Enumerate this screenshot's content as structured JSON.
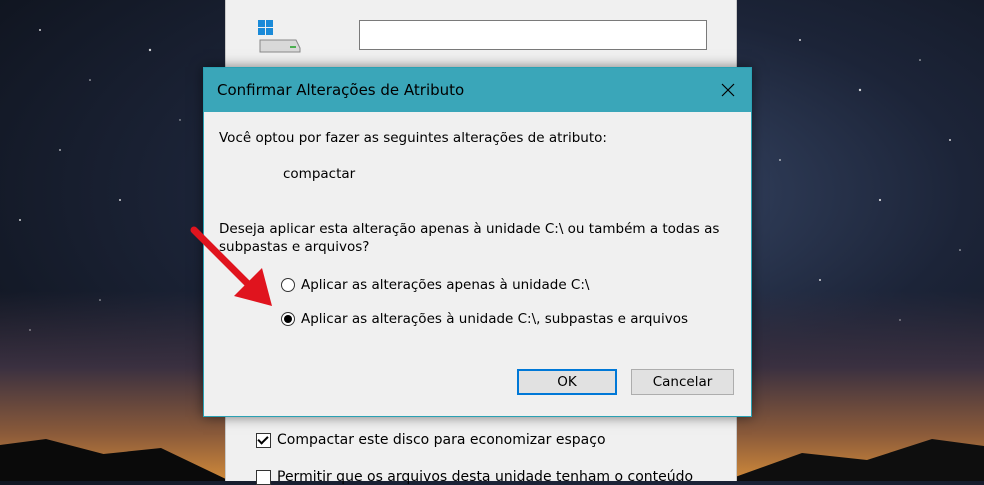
{
  "background_panel": {
    "drive_name_value": "",
    "compress_checkbox_label": "Compactar este disco para economizar espaço",
    "compress_checked": true,
    "index_checkbox_label": "Permitir que os arquivos desta unidade tenham o conteúdo",
    "index_checked": false
  },
  "dialog": {
    "title": "Confirmar Alterações de Atributo",
    "intro": "Você optou por fazer as seguintes alterações de atributo:",
    "change": "compactar",
    "question_line1": "Deseja aplicar esta alteração apenas à unidade C:\\ ou também a todas as",
    "question_line2": "subpastas e arquivos?",
    "options": [
      {
        "label": "Aplicar as alterações apenas à unidade C:\\",
        "selected": false
      },
      {
        "label": "Aplicar as alterações à unidade C:\\, subpastas e arquivos",
        "selected": true
      }
    ],
    "ok_label": "OK",
    "cancel_label": "Cancelar"
  },
  "colors": {
    "titlebar": "#3aa6b9",
    "focus_border": "#0078d7",
    "annotation_arrow": "#e0141e"
  },
  "icons": [
    "drive-icon",
    "close-icon",
    "annotation-arrow"
  ]
}
